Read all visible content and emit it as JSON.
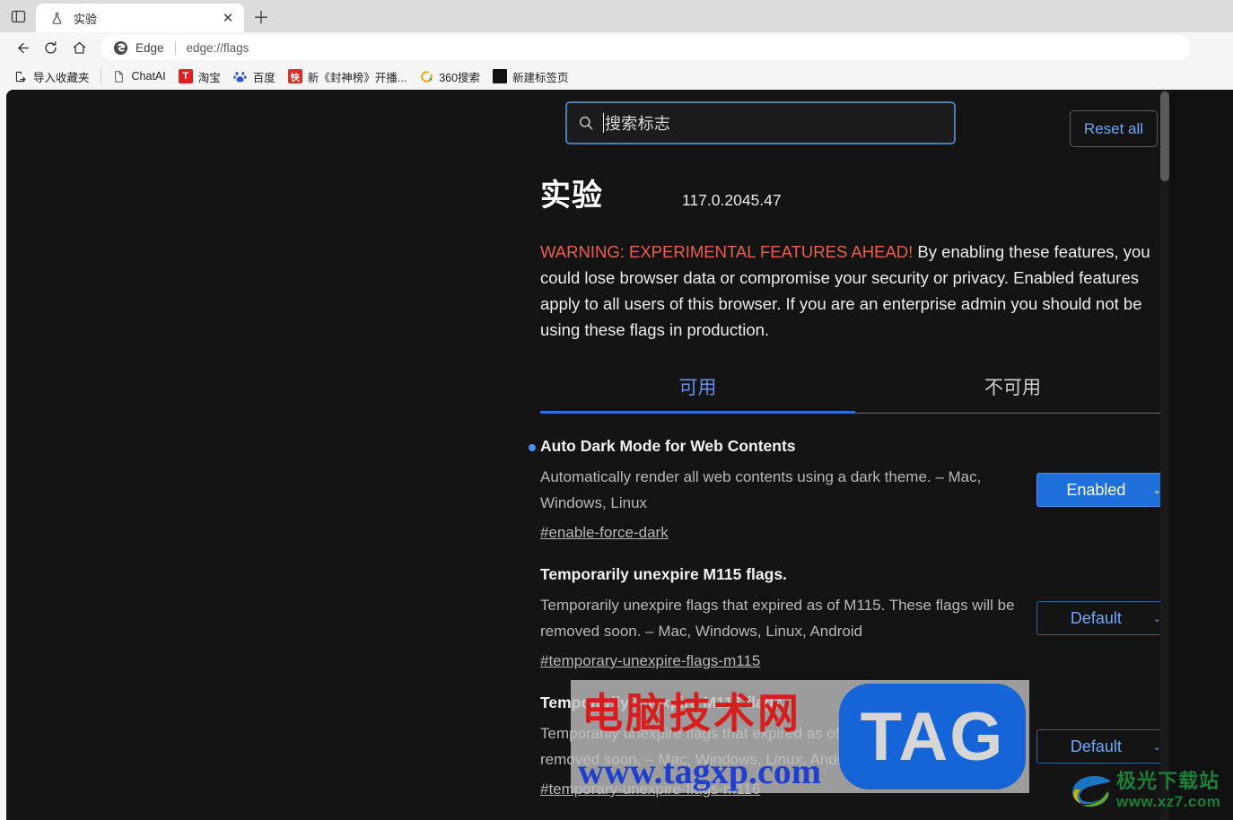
{
  "browser": {
    "tab": {
      "title": "实验",
      "favicon": "flask-icon",
      "close_label": "✕"
    },
    "new_tab_label": "＋",
    "sidebar_toggle": "sidebar-icon",
    "toolbar": {
      "back": "back-arrow-icon",
      "reload": "reload-icon",
      "home": "home-icon",
      "brand": "Edge",
      "url": "edge://flags"
    },
    "bookmarks": [
      {
        "label": "导入收藏夹",
        "icon": "import-favorites-icon",
        "icon_bg": "transparent",
        "icon_fg": "#1f1f1f",
        "glyph": ""
      },
      {
        "label": "ChatAI",
        "icon": "document-icon",
        "icon_bg": "transparent",
        "icon_fg": "#1f1f1f",
        "glyph": ""
      },
      {
        "label": "淘宝",
        "icon": "taobao-icon",
        "icon_bg": "#e02020",
        "icon_fg": "#ffffff",
        "glyph": "T"
      },
      {
        "label": "百度",
        "icon": "baidu-icon",
        "icon_bg": "transparent",
        "icon_fg": "#2e55d4",
        "glyph": "熊"
      },
      {
        "label": "新《封神榜》开播...",
        "icon": "kuaikan-icon",
        "icon_bg": "#d93025",
        "icon_fg": "#ffffff",
        "glyph": "快"
      },
      {
        "label": "360搜索",
        "icon": "so360-icon",
        "icon_bg": "transparent",
        "icon_fg": "#f2a000",
        "glyph": "O"
      },
      {
        "label": "新建标签页",
        "icon": "newtab-page-icon",
        "icon_bg": "#111111",
        "icon_fg": "#111111",
        "glyph": ""
      }
    ]
  },
  "flags_page": {
    "search": {
      "placeholder": "搜索标志",
      "value": "",
      "icon": "search-icon"
    },
    "reset_all_label": "Reset all",
    "title": "实验",
    "version": "117.0.2045.47",
    "warning": {
      "highlight": "WARNING: EXPERIMENTAL FEATURES AHEAD!",
      "body": " By enabling these features, you could lose browser data or compromise your security or privacy. Enabled features apply to all users of this browser. If you are an enterprise admin you should not be using these flags in production."
    },
    "tabs": [
      {
        "label": "可用",
        "active": true
      },
      {
        "label": "不可用",
        "active": false
      }
    ],
    "flags": [
      {
        "title": "Auto Dark Mode for Web Contents",
        "modified": true,
        "description": "Automatically render all web contents using a dark theme. – Mac, Windows, Linux",
        "link": "#enable-force-dark",
        "select_value": "Enabled",
        "select_state": "enabled",
        "chevron": "⌄"
      },
      {
        "title": "Temporarily unexpire M115 flags.",
        "modified": false,
        "description": "Temporarily unexpire flags that expired as of M115. These flags will be removed soon. – Mac, Windows, Linux, Android",
        "link": "#temporary-unexpire-flags-m115",
        "select_value": "Default",
        "select_state": "default",
        "chevron": "⌄"
      },
      {
        "title": "Temporarily unexpire M116 flags.",
        "modified": false,
        "description": "Temporarily unexpire flags that expired as of M116. These flags will be removed soon. – Mac, Windows, Linux, Android",
        "link": "#temporary-unexpire-flags-m116",
        "select_value": "Default",
        "select_state": "default",
        "chevron": "⌄"
      }
    ]
  },
  "watermarks": {
    "center": {
      "cn_text": "电脑技术网",
      "url_text": "www.tagxp.com",
      "badge_text": "TAG"
    },
    "corner": {
      "cn_text": "极光下载站",
      "url_text": "www.xz7.com"
    }
  },
  "colors": {
    "accent_blue": "#2f6fe0",
    "link_blue": "#6ea8fb",
    "warning_red": "#e8604d",
    "page_bg": "#141414"
  }
}
